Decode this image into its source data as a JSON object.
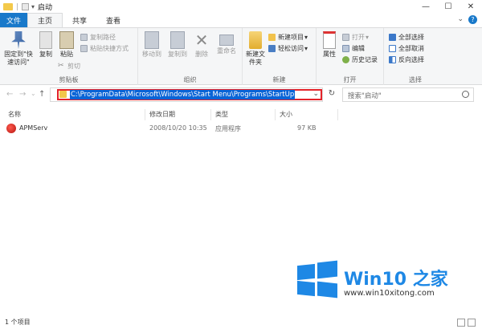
{
  "window": {
    "title": "启动",
    "minimize": "—",
    "maximize": "☐",
    "close": "✕"
  },
  "tabs": [
    {
      "label": "文件"
    },
    {
      "label": "主页"
    },
    {
      "label": "共享"
    },
    {
      "label": "查看"
    }
  ],
  "ribbon": {
    "clipboard": {
      "label": "剪贴板",
      "pin": "固定到\"快速访问\"",
      "copy": "复制",
      "paste": "粘贴",
      "copy_path": "复制路径",
      "paste_shortcut": "粘贴快捷方式",
      "cut": "剪切"
    },
    "organize": {
      "label": "组织",
      "move_to": "移动到",
      "copy_to": "复制到",
      "delete": "删除",
      "rename": "重命名"
    },
    "new": {
      "label": "新建",
      "new_folder": "新建文件夹",
      "new_item": "新建项目",
      "easy_access": "轻松访问"
    },
    "open": {
      "label": "打开",
      "properties": "属性",
      "open": "打开",
      "edit": "编辑",
      "history": "历史记录"
    },
    "select": {
      "label": "选择",
      "select_all": "全部选择",
      "select_none": "全部取消",
      "invert": "反向选择"
    }
  },
  "address": {
    "path": "C:\\ProgramData\\Microsoft\\Windows\\Start Menu\\Programs\\StartUp",
    "search_placeholder": "搜索\"启动\""
  },
  "columns": [
    "名称",
    "修改日期",
    "类型",
    "大小"
  ],
  "files": [
    {
      "name": "APMServ",
      "modified": "2008/10/20 10:35",
      "type": "应用程序",
      "size": "97 KB"
    }
  ],
  "status": {
    "count": "1 个项目"
  },
  "watermark": {
    "title": "Win10 之家",
    "url": "www.win10xitong.com"
  },
  "colors": {
    "accent": "#1979ca",
    "selection": "#0a64d6",
    "highlight_box": "#e4232a"
  }
}
